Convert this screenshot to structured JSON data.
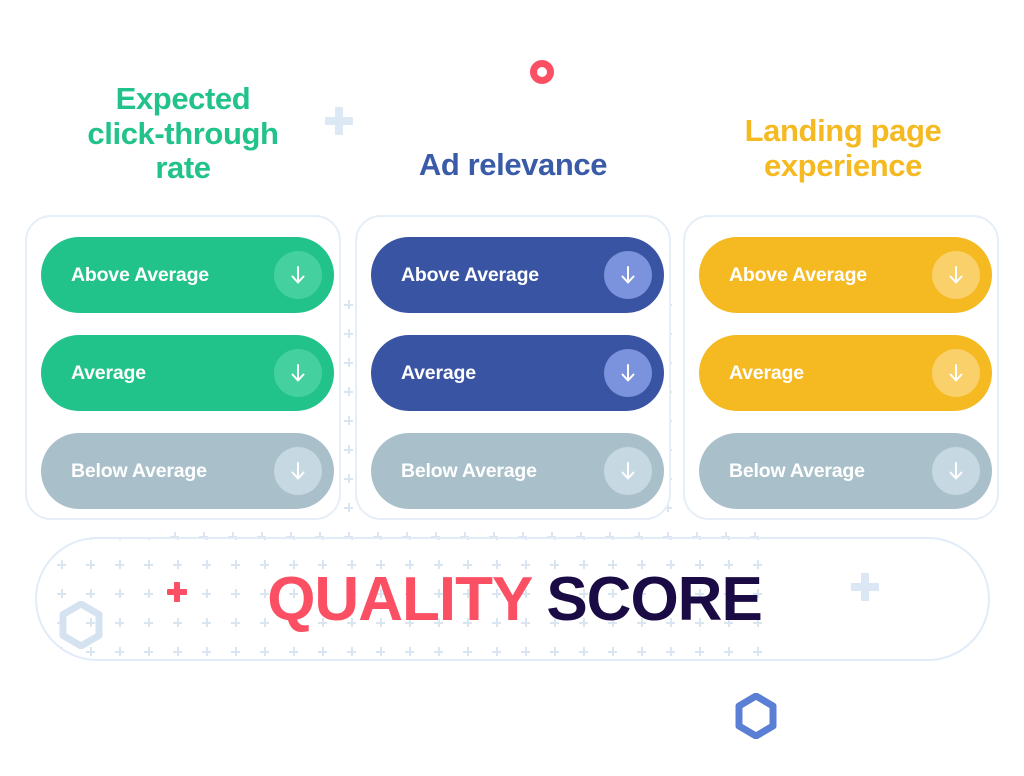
{
  "page": {
    "title": "Quality Score factors",
    "background_color": "#ffffff"
  },
  "colors": {
    "green": "#22C38A",
    "blue": "#3A54A4",
    "yellow": "#F5B921",
    "grey": "#A9C0CA",
    "coral": "#FB5064",
    "navy": "#1A0B45",
    "card_border": "#e6eef8",
    "pattern": "#d9e5f1"
  },
  "columns": [
    {
      "id": "expected-click-through-rate",
      "title": "Expected click-through rate",
      "title_lines": [
        "Expected",
        "click-through",
        "rate"
      ],
      "accent": "#22C38A",
      "ratings": [
        {
          "label": "Above Average",
          "state": "active",
          "color": "#22C38A",
          "icon": "arrow-down-icon"
        },
        {
          "label": "Average",
          "state": "active",
          "color": "#22C38A",
          "icon": "arrow-down-icon"
        },
        {
          "label": "Below Average",
          "state": "muted",
          "color": "#A9C0CA",
          "icon": "arrow-down-icon"
        }
      ]
    },
    {
      "id": "ad-relevance",
      "title": "Ad relevance",
      "title_lines": [
        "Ad relevance"
      ],
      "accent": "#3A54A4",
      "ratings": [
        {
          "label": "Above Average",
          "state": "active",
          "color": "#3A54A4",
          "icon": "arrow-down-icon"
        },
        {
          "label": "Average",
          "state": "active",
          "color": "#3A54A4",
          "icon": "arrow-down-icon"
        },
        {
          "label": "Below Average",
          "state": "muted",
          "color": "#A9C0CA",
          "icon": "arrow-down-icon"
        }
      ]
    },
    {
      "id": "landing-page-experience",
      "title": "Landing page experience",
      "title_lines": [
        "Landing page",
        "experience"
      ],
      "accent": "#F5B921",
      "ratings": [
        {
          "label": "Above Average",
          "state": "active",
          "color": "#F5B921",
          "icon": "arrow-down-icon"
        },
        {
          "label": "Average",
          "state": "active",
          "color": "#F5B921",
          "icon": "arrow-down-icon"
        },
        {
          "label": "Below Average",
          "state": "muted",
          "color": "#A9C0CA",
          "icon": "arrow-down-icon"
        }
      ]
    }
  ],
  "result": {
    "word_1": "QUALITY",
    "word_2": "SCORE",
    "word_1_color": "#FB5064",
    "word_2_color": "#1A0B45"
  },
  "decorations": [
    {
      "name": "ring-top",
      "shape": "circle-outline",
      "color": "#FB5064"
    },
    {
      "name": "plus-top",
      "shape": "plus",
      "color": "#dde8f5"
    },
    {
      "name": "plus-score-left",
      "shape": "plus",
      "color": "#FB5064"
    },
    {
      "name": "plus-score-right",
      "shape": "plus",
      "color": "#dbe7f5"
    },
    {
      "name": "hex-score",
      "shape": "hexagon-outline",
      "color": "#d5e3f1"
    },
    {
      "name": "hex-bottom",
      "shape": "hexagon-outline",
      "color": "#5b7fd4"
    }
  ]
}
